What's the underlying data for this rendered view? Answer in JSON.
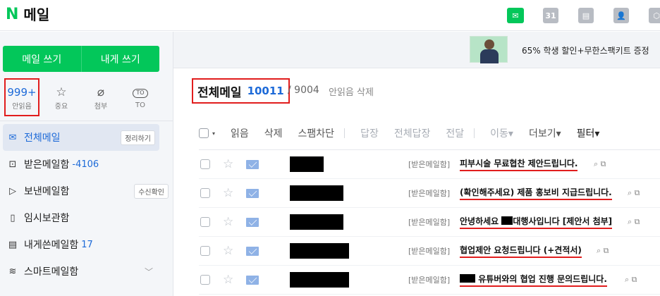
{
  "header": {
    "logo": "N",
    "title": "메일",
    "app_icons": [
      {
        "icon": "naver-mail-icon",
        "label": "",
        "color": "#03c75a"
      },
      {
        "icon": "calendar-icon",
        "label": "31"
      },
      {
        "icon": "memo-icon",
        "label": ""
      },
      {
        "icon": "contacts-icon",
        "label": ""
      },
      {
        "icon": "mybox-icon",
        "label": ""
      }
    ]
  },
  "sidebar": {
    "compose": {
      "write_label": "메일 쓰기",
      "self_write_label": "내게 쓰기"
    },
    "quick": [
      {
        "top": "999+",
        "label": "안읽음",
        "highlighted": true
      },
      {
        "icon": "star-icon",
        "glyph": "☆",
        "label": "중요"
      },
      {
        "icon": "paperclip-icon",
        "glyph": "📎",
        "label": "첨부"
      },
      {
        "icon": "to-icon",
        "glyph": "TO",
        "label": "TO"
      }
    ],
    "folders": [
      {
        "icon": "mail-icon",
        "glyph": "✉",
        "label": "전체메일",
        "count": "",
        "pill": "정리하기",
        "active": true
      },
      {
        "icon": "inbox-icon",
        "glyph": "⊡",
        "label": "받은메일함",
        "count": "-4106",
        "pill": ""
      },
      {
        "icon": "send-icon",
        "glyph": "▷",
        "label": "보낸메일함",
        "count": "",
        "pill": "수신확인"
      },
      {
        "icon": "draft-icon",
        "glyph": "▯",
        "label": "임시보관함",
        "count": "",
        "pill": ""
      },
      {
        "icon": "self-mail-icon",
        "glyph": "▤",
        "label": "내게쓴메일함",
        "count": "17",
        "pill": ""
      },
      {
        "icon": "smart-mail-icon",
        "glyph": "≋",
        "label": "스마트메일함",
        "count": "",
        "pill": "",
        "chevron": "﹀"
      }
    ]
  },
  "ad": {
    "text": "65% 학생 할인+무한스팩키트 증정"
  },
  "main": {
    "title": "전체메일",
    "count": "10011",
    "total": "/ 9004",
    "unread_delete": "안읽음 삭제",
    "toolbar": {
      "caret": "▾",
      "read": "읽음",
      "delete": "삭제",
      "spam": "스팸차단",
      "reply": "답장",
      "reply_all": "전체답장",
      "forward": "전달",
      "move": "이동▾",
      "more": "더보기▾",
      "filter": "필터▾"
    },
    "rows": [
      {
        "folder": "[받은메일함]",
        "subject_pre": "",
        "subject": "피부시술 무료협찬 제안드립니다.",
        "tools": "⌕ ⧉"
      },
      {
        "folder": "[받은메일함]",
        "subject_pre": "",
        "subject": "(확인해주세요) 제품 홍보비 지급드립니다.",
        "tools": "⌕ ⧉"
      },
      {
        "folder": "[받은메일함]",
        "subject_pre": "안녕하세요",
        "subject": "대행사입니다 [제안서 첨부]",
        "tools": "⌕ ⧉"
      },
      {
        "folder": "[받은메일함]",
        "subject_pre": "",
        "subject": "협업제안 요청드립니다 (+견적서)",
        "tools": "⌕ ⧉"
      },
      {
        "folder": "[받은메일함]",
        "subject_pre": "",
        "subject": "유튜버와의 협업 진행 문의드립니다.",
        "tools": "⌕ ⧉"
      }
    ]
  },
  "colors": {
    "brand": "#03c75a",
    "accent": "#1d6ad8",
    "highlight": "#e11d1d"
  }
}
